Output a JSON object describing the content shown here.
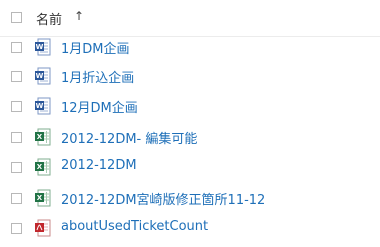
{
  "list": {
    "header": {
      "name_label": "名前",
      "sort_arrow": "↑"
    },
    "rows": [
      {
        "name": "1月DM企画",
        "icon": "word-file-icon",
        "color": "#2b579a"
      },
      {
        "name": "1月折込企画",
        "icon": "word-file-icon",
        "color": "#2b579a"
      },
      {
        "name": "12月DM企画",
        "icon": "word-file-icon",
        "color": "#2b579a"
      },
      {
        "name": "2012-12DM- 編集可能",
        "icon": "excel-file-icon",
        "color": "#217346"
      },
      {
        "name": "2012-12DM",
        "icon": "excel-file-icon",
        "color": "#217346"
      },
      {
        "name": "2012-12DM宮崎版修正箇所11-12",
        "icon": "excel-file-icon",
        "color": "#217346"
      },
      {
        "name": "aboutUsedTicketCount",
        "icon": "pdf-file-icon",
        "color": "#c1272d"
      }
    ],
    "link_color": "#1e6fb8"
  }
}
